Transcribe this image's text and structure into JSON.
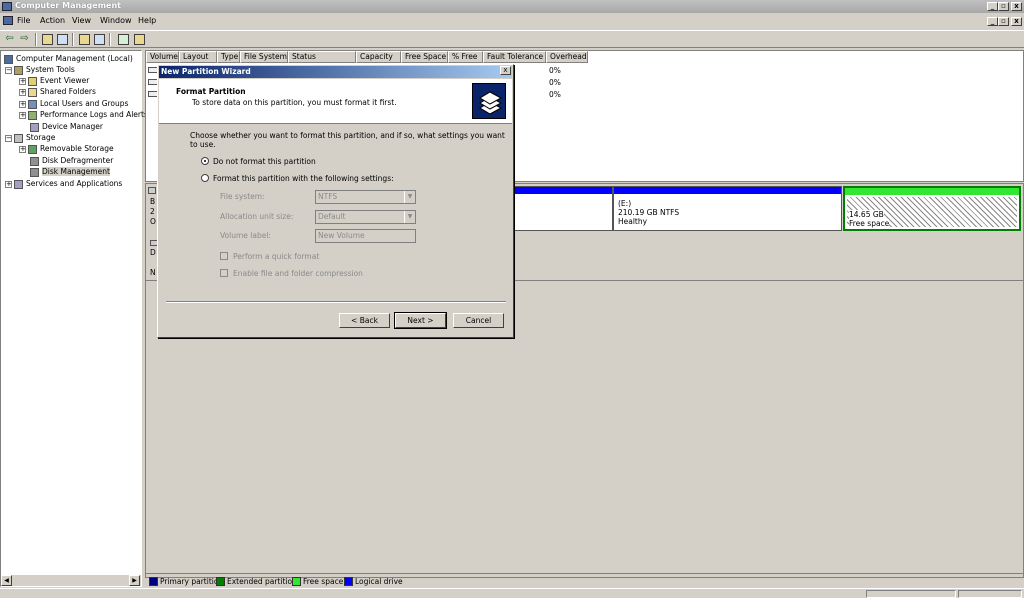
{
  "window": {
    "title": "Computer Management",
    "minimize": "_",
    "restore": "▫",
    "close": "x"
  },
  "doc_window": {
    "minimize": "_",
    "restore": "▫",
    "close": "x"
  },
  "menu": [
    "File",
    "Action",
    "View",
    "Window",
    "Help"
  ],
  "toolbar": {
    "back": "⇦",
    "forward": "⇨",
    "icons": [
      "up-folder-icon",
      "console-tree-icon",
      "properties-icon",
      "refresh-icon",
      "help-icon",
      "export-icon"
    ]
  },
  "tree": {
    "items": [
      {
        "label": "Computer Management (Local)",
        "expander": "",
        "level": 0,
        "icon": "computer-icon"
      },
      {
        "label": "System Tools",
        "expander": "−",
        "level": 1,
        "icon": "tools-icon"
      },
      {
        "label": "Event Viewer",
        "expander": "+",
        "level": 2,
        "icon": "event-viewer-icon"
      },
      {
        "label": "Shared Folders",
        "expander": "+",
        "level": 2,
        "icon": "shared-folder-icon"
      },
      {
        "label": "Local Users and Groups",
        "expander": "+",
        "level": 2,
        "icon": "users-icon"
      },
      {
        "label": "Performance Logs and Alerts",
        "expander": "+",
        "level": 2,
        "icon": "performance-icon"
      },
      {
        "label": "Device Manager",
        "expander": "",
        "level": 2,
        "icon": "device-manager-icon"
      },
      {
        "label": "Storage",
        "expander": "−",
        "level": 1,
        "icon": "storage-icon"
      },
      {
        "label": "Removable Storage",
        "expander": "+",
        "level": 2,
        "icon": "removable-storage-icon"
      },
      {
        "label": "Disk Defragmenter",
        "expander": "",
        "level": 2,
        "icon": "defragmenter-icon"
      },
      {
        "label": "Disk Management",
        "expander": "",
        "level": 2,
        "icon": "disk-management-icon",
        "selected": true
      },
      {
        "label": "Services and Applications",
        "expander": "+",
        "level": 1,
        "icon": "services-icon"
      }
    ]
  },
  "volume_list": {
    "columns": [
      "Volume",
      "Layout",
      "Type",
      "File System",
      "Status",
      "Capacity",
      "Free Space",
      "% Free",
      "Fault Tolerance",
      "Overhead"
    ],
    "rows": [
      {
        "overhead": "0%"
      },
      {
        "overhead": "0%"
      },
      {
        "overhead": "0%"
      }
    ]
  },
  "disk_area": {
    "disk0_partial": [
      "B",
      "2",
      "O"
    ],
    "cdrom_partial": [
      "D"
    ],
    "other_partial": [
      "N"
    ],
    "partitions": [
      {
        "name": "(E:)",
        "size": "210.19 GB NTFS",
        "status": "Healthy",
        "bar_color": "#0000ff"
      },
      {
        "name": "",
        "size": "14.65 GB",
        "status": "Free space",
        "bar_color": "#33e633"
      }
    ]
  },
  "legend": [
    {
      "label": "Primary partition",
      "color": "#00007f"
    },
    {
      "label": "Extended partition",
      "color": "#007f00"
    },
    {
      "label": "Free space",
      "color": "#33e633"
    },
    {
      "label": "Logical drive",
      "color": "#0000ff"
    }
  ],
  "wizard": {
    "title": "New Partition Wizard",
    "close": "x",
    "heading": "Format Partition",
    "subheading": "To store data on this partition, you must format it first.",
    "prompt": "Choose whether you want to format this partition, and if so, what settings you want to use.",
    "option_no_format": "Do not format this partition",
    "option_format": "Format this partition with the following settings:",
    "file_system_label": "File system:",
    "file_system_value": "NTFS",
    "allocation_label": "Allocation unit size:",
    "allocation_value": "Default",
    "volume_label_label": "Volume label:",
    "volume_label_value": "New Volume",
    "quick_format": "Perform a quick format",
    "compression": "Enable file and folder compression",
    "back": "< Back",
    "next": "Next >",
    "cancel": "Cancel"
  }
}
